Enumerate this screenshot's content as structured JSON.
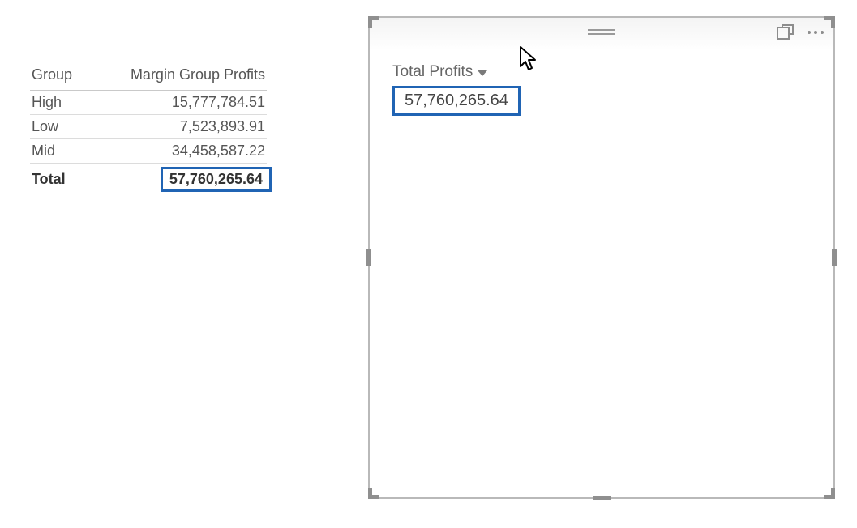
{
  "matrix": {
    "columns": {
      "group": "Group",
      "profits": "Margin Group Profits"
    },
    "rows": [
      {
        "group": "High",
        "profits": "15,777,784.51"
      },
      {
        "group": "Low",
        "profits": "7,523,893.91"
      },
      {
        "group": "Mid",
        "profits": "34,458,587.22"
      }
    ],
    "total": {
      "label": "Total",
      "value": "57,760,265.64"
    }
  },
  "card": {
    "title": "Total Profits",
    "value": "57,760,265.64"
  },
  "chart_data": {
    "type": "table",
    "title": "Margin Group Profits",
    "columns": [
      "Group",
      "Margin Group Profits"
    ],
    "rows": [
      [
        "High",
        15777784.51
      ],
      [
        "Low",
        7523893.91
      ],
      [
        "Mid",
        34458587.22
      ]
    ],
    "total": 57760265.64
  }
}
